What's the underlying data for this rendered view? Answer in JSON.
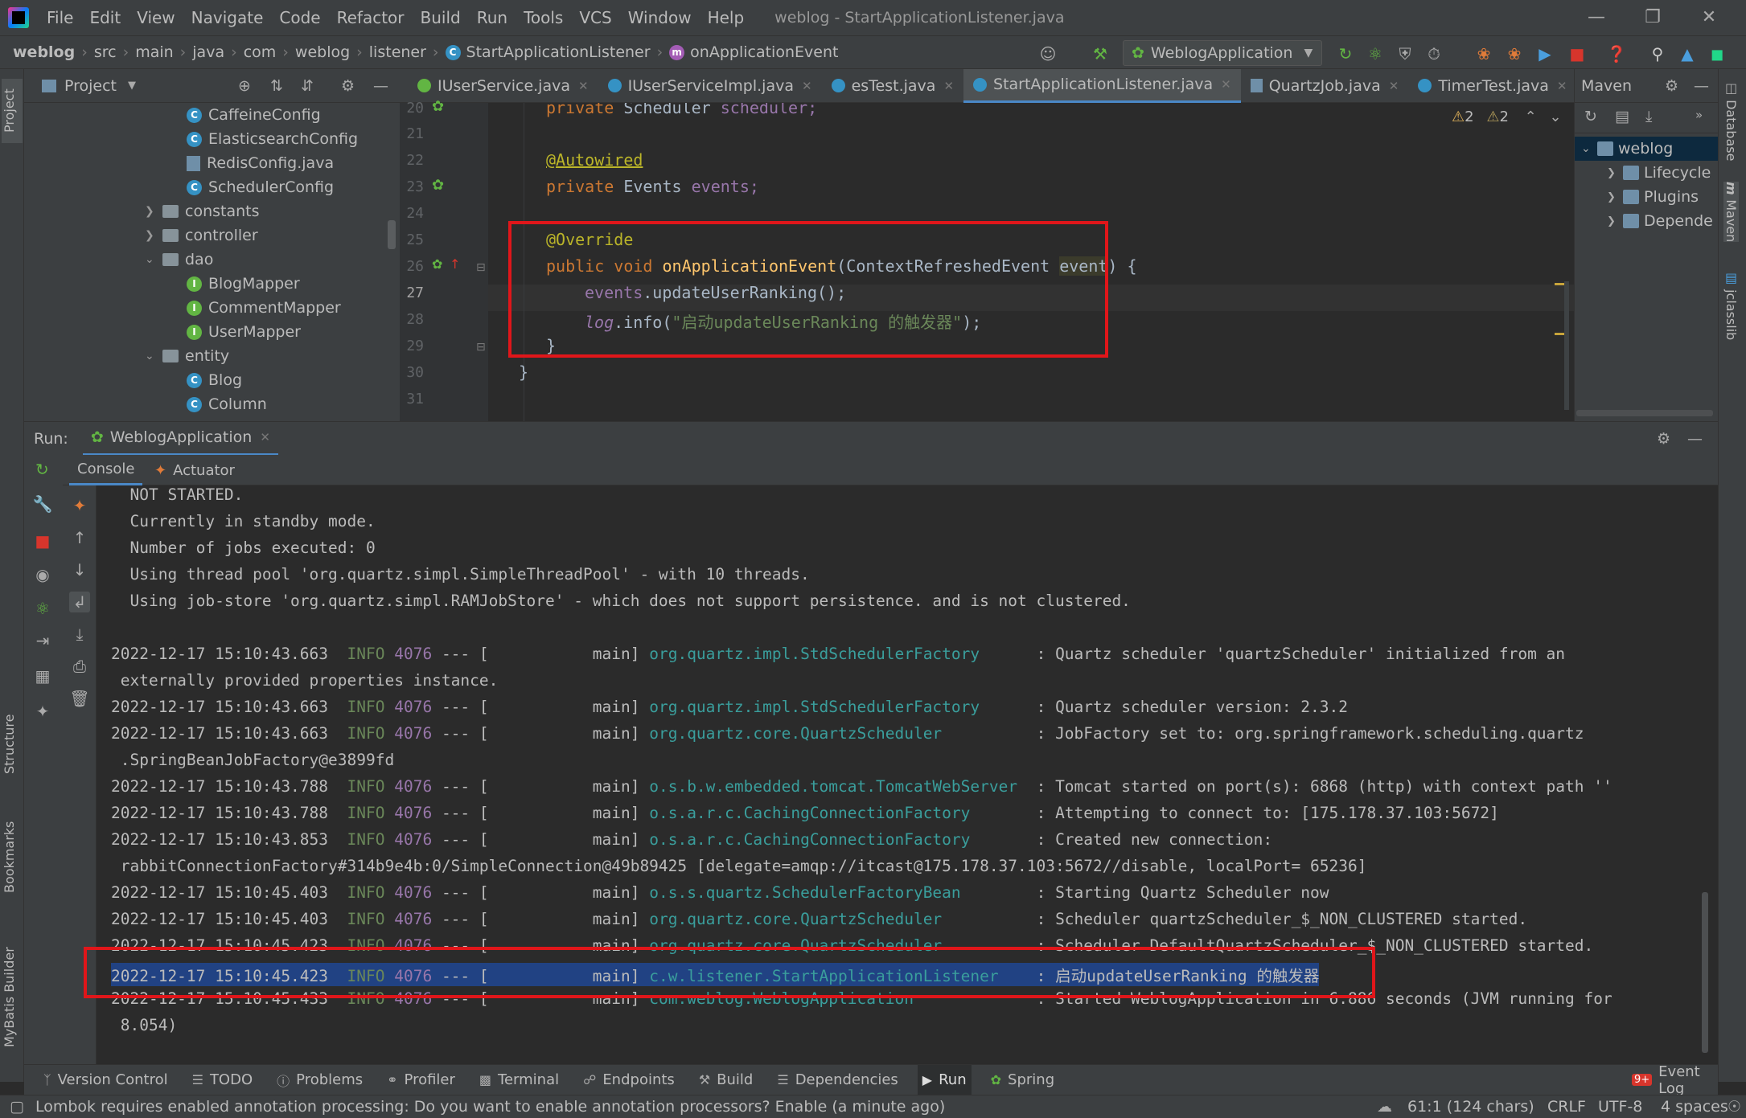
{
  "menu": [
    "File",
    "Edit",
    "View",
    "Navigate",
    "Code",
    "Refactor",
    "Build",
    "Run",
    "Tools",
    "VCS",
    "Window",
    "Help"
  ],
  "window_title": "weblog - StartApplicationListener.java",
  "breadcrumbs": [
    "weblog",
    "src",
    "main",
    "java",
    "com",
    "weblog",
    "listener",
    "StartApplicationListener",
    "onApplicationEvent"
  ],
  "run_config": "WeblogApplication",
  "project": {
    "title": "Project",
    "tree": [
      {
        "label": "CaffeineConfig",
        "kind": "class"
      },
      {
        "label": "ElasticsearchConfig",
        "kind": "class"
      },
      {
        "label": "RedisConfig.java",
        "kind": "java"
      },
      {
        "label": "SchedulerConfig",
        "kind": "class"
      },
      {
        "label": "constants",
        "kind": "folder"
      },
      {
        "label": "controller",
        "kind": "folder"
      },
      {
        "label": "dao",
        "kind": "folder-open"
      },
      {
        "label": "BlogMapper",
        "kind": "interface"
      },
      {
        "label": "CommentMapper",
        "kind": "interface"
      },
      {
        "label": "UserMapper",
        "kind": "interface"
      },
      {
        "label": "entity",
        "kind": "folder-open"
      },
      {
        "label": "Blog",
        "kind": "class"
      },
      {
        "label": "Column",
        "kind": "class"
      }
    ]
  },
  "editor_tabs": [
    {
      "label": "IUserService.java",
      "icon": "interface"
    },
    {
      "label": "IUserServiceImpl.java",
      "icon": "class"
    },
    {
      "label": "esTest.java",
      "icon": "class"
    },
    {
      "label": "StartApplicationListener.java",
      "icon": "class",
      "active": true
    },
    {
      "label": "QuartzJob.java",
      "icon": "java"
    },
    {
      "label": "TimerTest.java",
      "icon": "class"
    }
  ],
  "inspection": {
    "warnings": "2",
    "weak_warnings": "2"
  },
  "code": {
    "line_numbers": [
      "20",
      "21",
      "22",
      "23",
      "24",
      "25",
      "26",
      "27",
      "28",
      "29",
      "30",
      "31"
    ],
    "l20_kw": "private",
    "l20_type": "Scheduler",
    "l20_field": "scheduler;",
    "l22_ann": "@Autowired",
    "l23_kw": "private",
    "l23_type": "Events",
    "l23_field": "events;",
    "l25_ann": "@Override",
    "l26_kw": "public void",
    "l26_fn": "onApplicationEvent",
    "l26_param_type": "(ContextRefreshedEvent ",
    "l26_param": "event",
    "l26_end": ") {",
    "l27_obj": "events",
    "l27_rest": ".updateUserRanking();",
    "l28_obj": "log",
    "l28_mid": ".info(",
    "l28_str": "\"启动updateUserRanking 的触发器\"",
    "l28_end": ");",
    "l29": "}",
    "l30": "}"
  },
  "maven": {
    "title": "Maven",
    "items": [
      {
        "label": "weblog",
        "selected": true
      },
      {
        "label": "Lifecycle"
      },
      {
        "label": "Plugins"
      },
      {
        "label": "Depende"
      }
    ]
  },
  "side_tabs": {
    "left": [
      "Project",
      "Structure",
      "Bookmarks",
      "MyBatis Builder"
    ],
    "right": [
      "Database",
      "Maven",
      "jclasslib"
    ]
  },
  "run": {
    "label": "Run:",
    "config": "WeblogApplication",
    "tabs": [
      "Console",
      "Actuator"
    ]
  },
  "console": {
    "pre_lines": [
      "  NOT STARTED.",
      "  Currently in standby mode.",
      "  Number of jobs executed: 0",
      "  Using thread pool 'org.quartz.simpl.SimpleThreadPool' - with 10 threads.",
      "  Using job-store 'org.quartz.simpl.RAMJobStore' - which does not support persistence. and is not clustered."
    ],
    "logs": [
      {
        "ts": "2022-12-17 15:10:43.663",
        "lvl": "INFO",
        "pid": "4076",
        "thr": " --- [           main] ",
        "logger": "org.quartz.impl.StdSchedulerFactory     ",
        "msg": " : Quartz scheduler 'quartzScheduler' initialized from an",
        "cont": " externally provided properties instance."
      },
      {
        "ts": "2022-12-17 15:10:43.663",
        "lvl": "INFO",
        "pid": "4076",
        "thr": " --- [           main] ",
        "logger": "org.quartz.impl.StdSchedulerFactory     ",
        "msg": " : Quartz scheduler version: 2.3.2"
      },
      {
        "ts": "2022-12-17 15:10:43.663",
        "lvl": "INFO",
        "pid": "4076",
        "thr": " --- [           main] ",
        "logger": "org.quartz.core.QuartzScheduler         ",
        "msg": " : JobFactory set to: org.springframework.scheduling.quartz",
        "cont": " .SpringBeanJobFactory@e3899fd"
      },
      {
        "ts": "2022-12-17 15:10:43.788",
        "lvl": "INFO",
        "pid": "4076",
        "thr": " --- [           main] ",
        "logger": "o.s.b.w.embedded.tomcat.TomcatWebServer ",
        "msg": " : Tomcat started on port(s): 6868 (http) with context path ''"
      },
      {
        "ts": "2022-12-17 15:10:43.788",
        "lvl": "INFO",
        "pid": "4076",
        "thr": " --- [           main] ",
        "logger": "o.s.a.r.c.CachingConnectionFactory      ",
        "msg": " : Attempting to connect to: [175.178.37.103:5672]"
      },
      {
        "ts": "2022-12-17 15:10:43.853",
        "lvl": "INFO",
        "pid": "4076",
        "thr": " --- [           main] ",
        "logger": "o.s.a.r.c.CachingConnectionFactory      ",
        "msg": " : Created new connection:",
        "cont": " rabbitConnectionFactory#314b9e4b:0/SimpleConnection@49b89425 [delegate=amqp://itcast@175.178.37.103:5672//disable, localPort= 65236]"
      },
      {
        "ts": "2022-12-17 15:10:45.403",
        "lvl": "INFO",
        "pid": "4076",
        "thr": " --- [           main] ",
        "logger": "o.s.s.quartz.SchedulerFactoryBean       ",
        "msg": " : Starting Quartz Scheduler now"
      },
      {
        "ts": "2022-12-17 15:10:45.403",
        "lvl": "INFO",
        "pid": "4076",
        "thr": " --- [           main] ",
        "logger": "org.quartz.core.QuartzScheduler         ",
        "msg": " : Scheduler quartzScheduler_$_NON_CLUSTERED started."
      },
      {
        "ts": "2022-12-17 15:10:45.423",
        "lvl": "INFO",
        "pid": "4076",
        "thr": " --- [           main] ",
        "logger": "org.quartz.core.QuartzScheduler         ",
        "msg": " : Scheduler DefaultQuartzScheduler_$_NON_CLUSTERED started."
      },
      {
        "ts": "2022-12-17 15:10:45.423",
        "lvl": "INFO",
        "pid": "4076",
        "thr": " --- [           main] ",
        "logger": "c.w.listener.StartApplicationListener   ",
        "msg": " : 启动updateUserRanking 的触发器",
        "selected": true
      },
      {
        "ts": "2022-12-17 15:10:45.433",
        "lvl": "INFO",
        "pid": "4076",
        "thr": " --- [           main] ",
        "logger": "com.weblog.WeblogApplication            ",
        "msg": " : Started WeblogApplication in 6.886 seconds (JVM running for",
        "cont": " 8.054)"
      }
    ]
  },
  "bottom_tools": [
    "Version Control",
    "TODO",
    "Problems",
    "Profiler",
    "Terminal",
    "Endpoints",
    "Build",
    "Dependencies",
    "Run",
    "Spring"
  ],
  "event_log": "Event Log",
  "status": {
    "message": "Lombok requires enabled annotation processing: Do you want to enable annotation processors? Enable (a minute ago)",
    "position": "61:1 (124 chars)",
    "line_sep": "CRLF",
    "encoding": "UTF-8",
    "indent": "4 spaces"
  },
  "colors": {
    "accent": "#4a88c7",
    "highlight_box": "#e0161a",
    "selection": "#214283"
  }
}
